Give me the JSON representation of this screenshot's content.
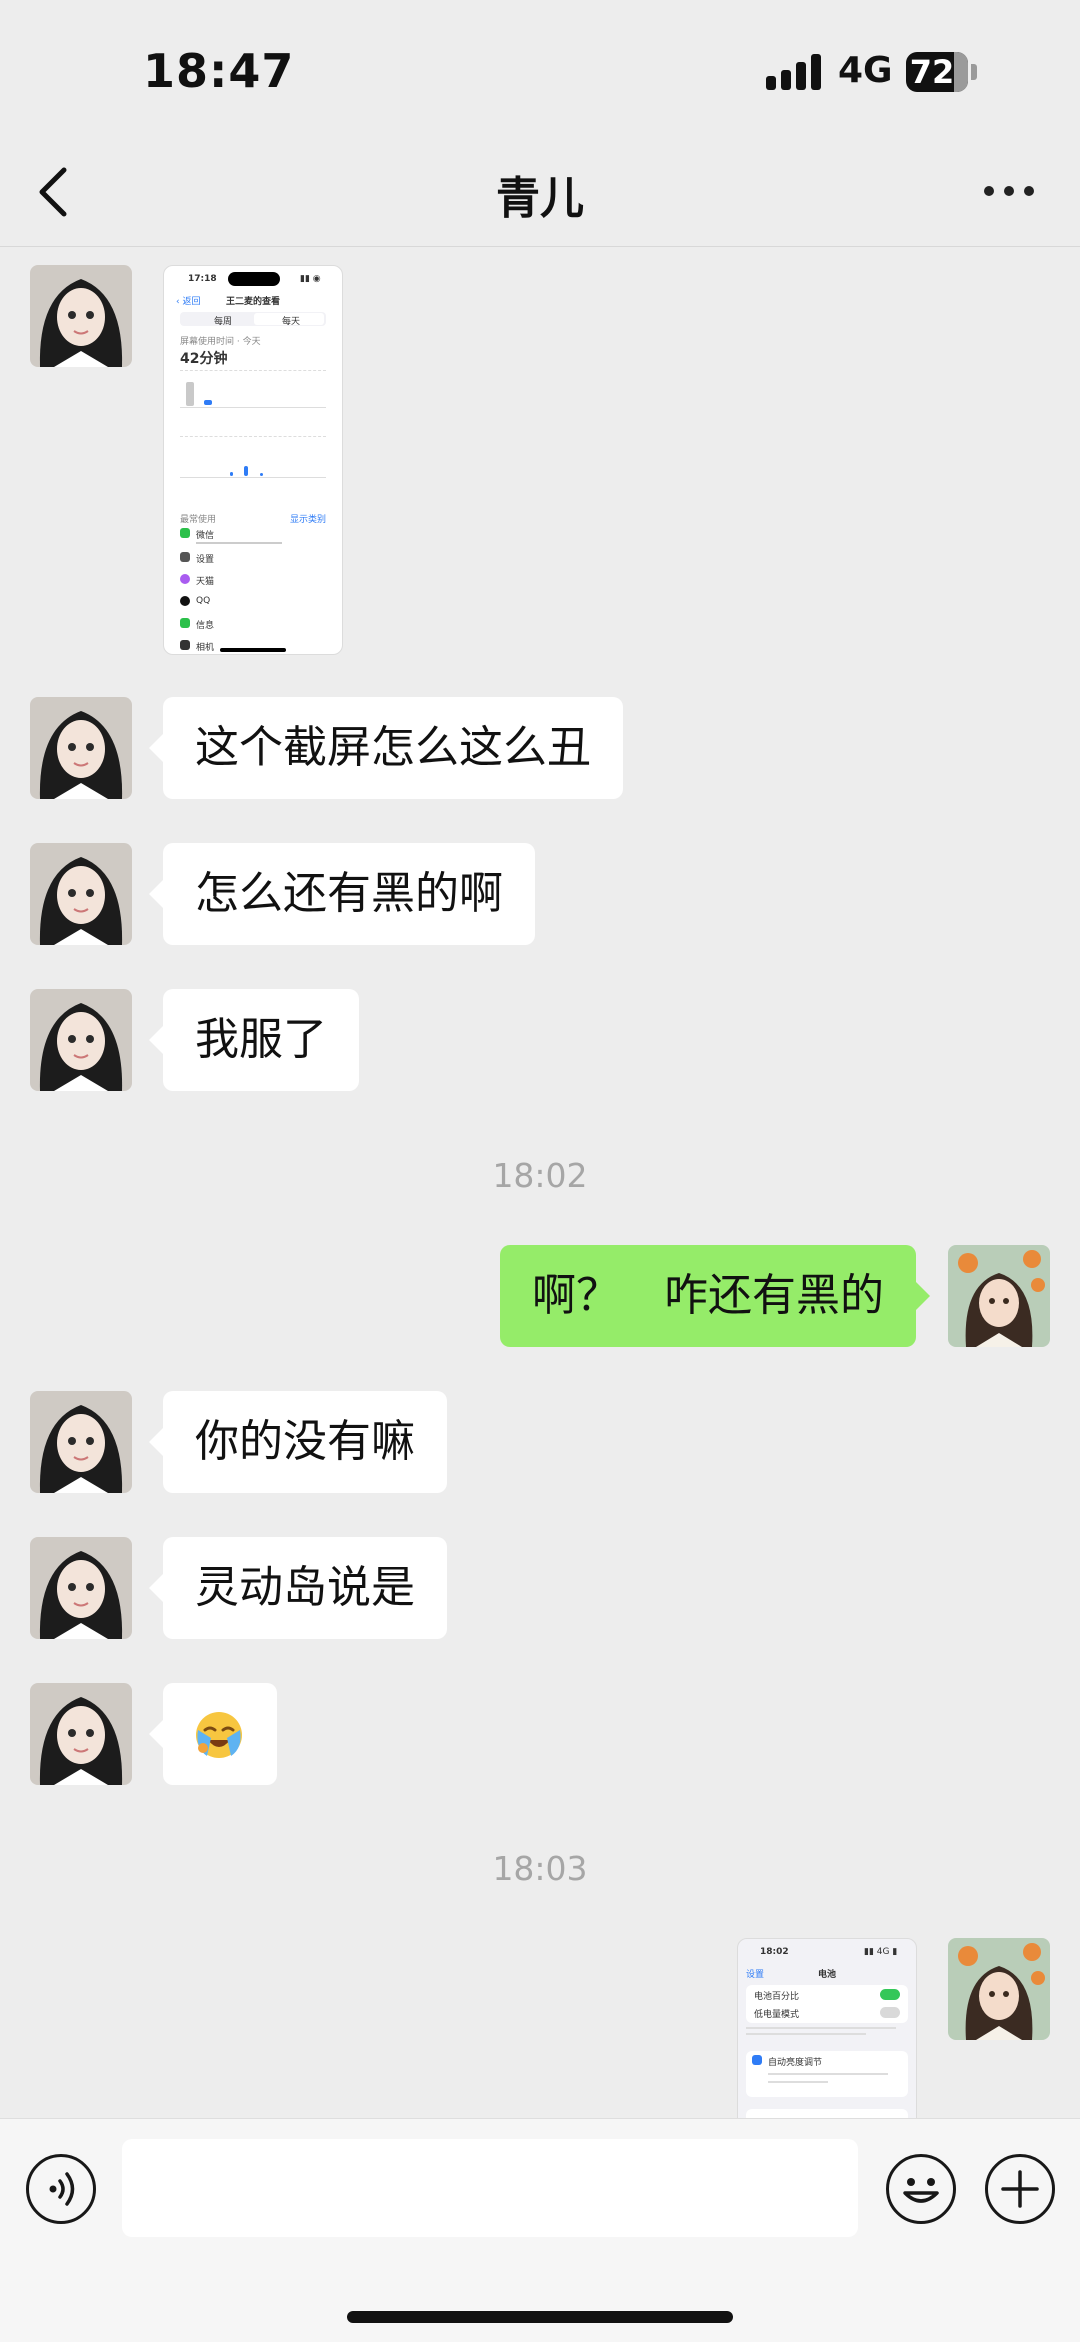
{
  "status_bar": {
    "time": "18:47",
    "network": "4G",
    "battery": "72",
    "battery_level": 0.72
  },
  "nav": {
    "title": "青儿",
    "back_icon": "chevron-left-icon",
    "more_icon": "more-dots-icon"
  },
  "messages": [
    {
      "from": "contact",
      "type": "image"
    },
    {
      "from": "contact",
      "type": "text",
      "text": "这个截屏怎么这么丑"
    },
    {
      "from": "contact",
      "type": "text",
      "text": "怎么还有黑的啊"
    },
    {
      "from": "contact",
      "type": "text",
      "text": "我服了"
    },
    {
      "type": "timestamp",
      "text": "18:02"
    },
    {
      "from": "me",
      "type": "text",
      "text": "啊？　咋还有黑的"
    },
    {
      "from": "contact",
      "type": "text",
      "text": "你的没有嘛"
    },
    {
      "from": "contact",
      "type": "text",
      "text": "灵动岛说是"
    },
    {
      "from": "contact",
      "type": "emoji",
      "text": "😭"
    },
    {
      "type": "timestamp",
      "text": "18:03"
    },
    {
      "from": "me",
      "type": "image"
    }
  ],
  "thumb1": {
    "time": "17:18",
    "header": "王二麦的查看",
    "segment_a": "每周",
    "segment_b": "每天",
    "label": "屏幕使用时间 · 今天",
    "total": "42分钟",
    "section": "最常使用",
    "show_all": "显示类别",
    "apps": [
      "微信",
      "设置",
      "天猫",
      "QQ",
      "信息",
      "相机"
    ]
  },
  "thumb2": {
    "time": "18:02",
    "back": "设置",
    "title": "电池",
    "row1": "电池百分比",
    "row2": "低电量模式",
    "row3": "自动亮度调节"
  },
  "input": {
    "voice_icon": "voice-icon",
    "emoji_icon": "emoji-icon",
    "plus_icon": "plus-icon"
  },
  "colors": {
    "background": "#ededed",
    "incoming_bubble": "#ffffff",
    "outgoing_bubble": "#95ec69",
    "timestamp": "#a6a6a6"
  }
}
